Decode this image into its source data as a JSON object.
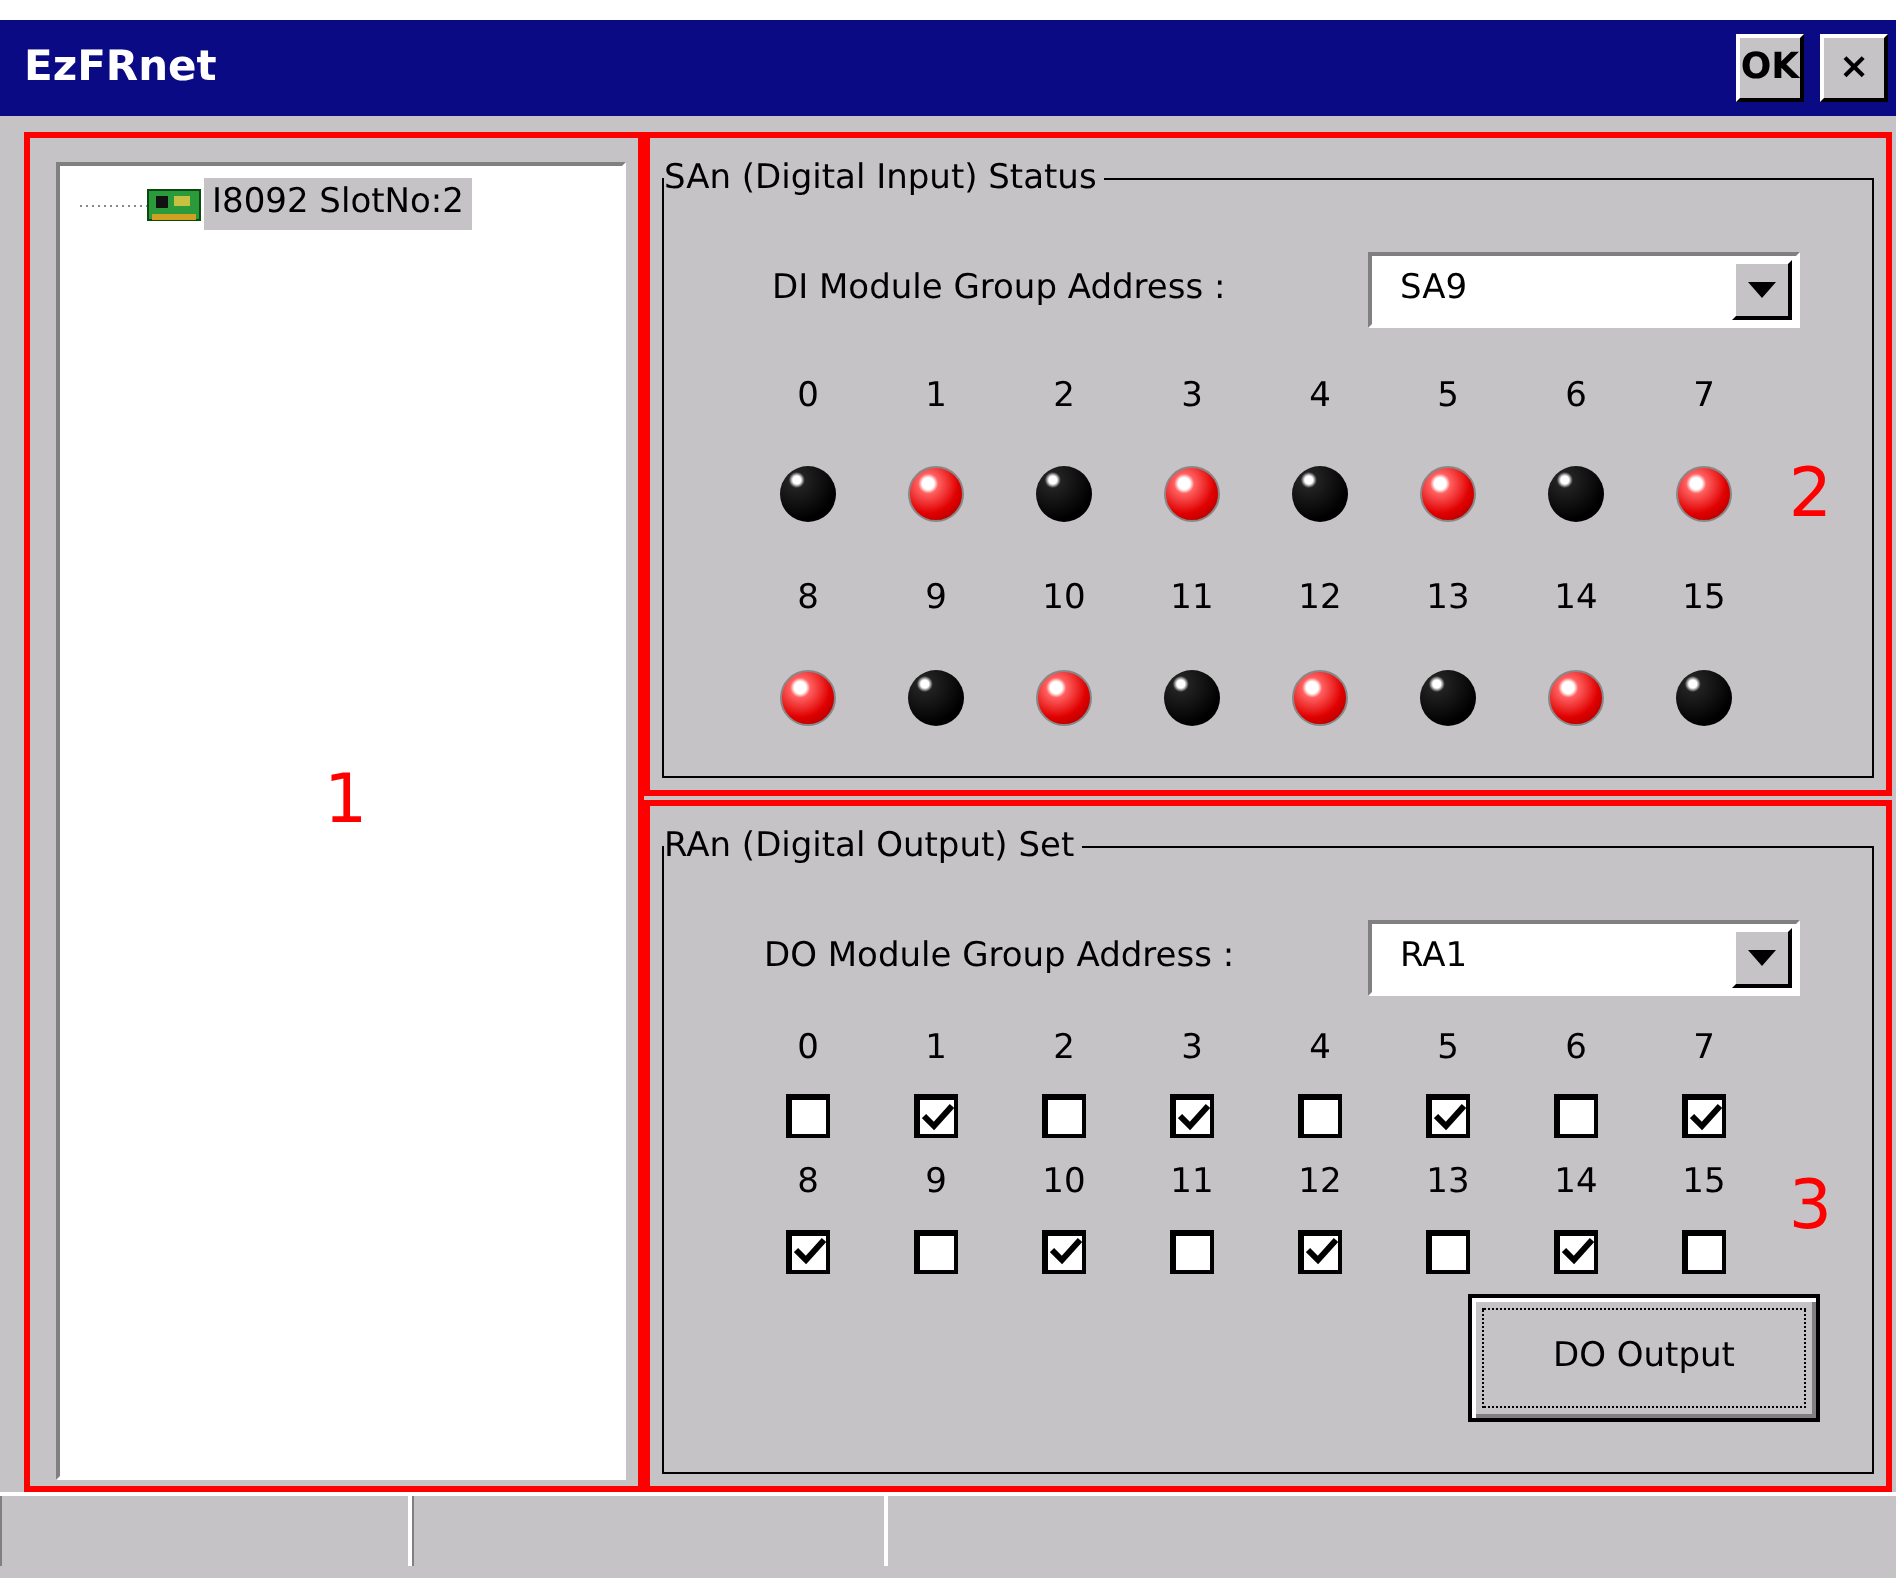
{
  "window": {
    "title": "EzFRnet",
    "buttons": [
      "OK",
      "×"
    ]
  },
  "tree": {
    "items": [
      {
        "label": "I8092 SlotNo:2",
        "selected": true
      }
    ]
  },
  "annotations": [
    "1",
    "2",
    "3"
  ],
  "di_panel": {
    "title": "SAn (Digital Input) Status",
    "address_label": "DI Module Group Address :",
    "address_value": "SA9",
    "inputs": [
      {
        "label": "0",
        "on": false
      },
      {
        "label": "1",
        "on": true
      },
      {
        "label": "2",
        "on": false
      },
      {
        "label": "3",
        "on": true
      },
      {
        "label": "4",
        "on": false
      },
      {
        "label": "5",
        "on": true
      },
      {
        "label": "6",
        "on": false
      },
      {
        "label": "7",
        "on": true
      },
      {
        "label": "8",
        "on": true
      },
      {
        "label": "9",
        "on": false
      },
      {
        "label": "10",
        "on": true
      },
      {
        "label": "11",
        "on": false
      },
      {
        "label": "12",
        "on": true
      },
      {
        "label": "13",
        "on": false
      },
      {
        "label": "14",
        "on": true
      },
      {
        "label": "15",
        "on": false
      }
    ]
  },
  "do_panel": {
    "title": "RAn (Digital Output) Set",
    "address_label": "DO Module Group Address :",
    "address_value": "RA1",
    "outputs": [
      {
        "label": "0",
        "checked": false
      },
      {
        "label": "1",
        "checked": true
      },
      {
        "label": "2",
        "checked": false
      },
      {
        "label": "3",
        "checked": true
      },
      {
        "label": "4",
        "checked": false
      },
      {
        "label": "5",
        "checked": true
      },
      {
        "label": "6",
        "checked": false
      },
      {
        "label": "7",
        "checked": true
      },
      {
        "label": "8",
        "checked": true
      },
      {
        "label": "9",
        "checked": false
      },
      {
        "label": "10",
        "checked": true
      },
      {
        "label": "11",
        "checked": false
      },
      {
        "label": "12",
        "checked": true
      },
      {
        "label": "13",
        "checked": false
      },
      {
        "label": "14",
        "checked": true
      },
      {
        "label": "15",
        "checked": false
      }
    ],
    "button": "DO Output"
  }
}
